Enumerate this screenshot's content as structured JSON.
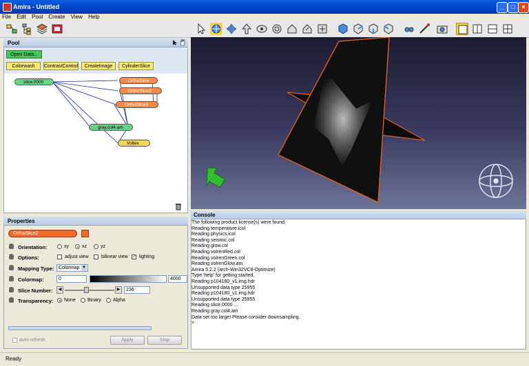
{
  "window": {
    "title": "Amira - Untitled"
  },
  "menu": [
    "File",
    "Edit",
    "Pool",
    "Create",
    "View",
    "Help"
  ],
  "pool": {
    "title": "Pool",
    "open_data": "Open Data...",
    "module_buttons": [
      "Colorwash",
      "ContrastControl",
      "CreateImage",
      "CylinderSlice"
    ],
    "nodes": {
      "slice": "slice.0000",
      "ortho1": "OrthoSlice",
      "ortho2": "OrthoSlice2",
      "ortho3": "OrthoSlice3",
      "gray": "gray.col4.am",
      "voltex": "Voltex"
    }
  },
  "properties": {
    "title": "Properties",
    "module": "OrthoSlice2",
    "orientation": {
      "label": "Orientation:",
      "options": [
        "xy",
        "xz",
        "yz"
      ],
      "selected": "xz"
    },
    "options": {
      "label": "Options:",
      "adjust": "adjust view",
      "bilinear": "bilinear view",
      "lighting": "lighting",
      "lighting_checked": true
    },
    "mapping": {
      "label": "Mapping Type:",
      "value": "Colormap"
    },
    "colormap": {
      "label": "Colormap:",
      "min": "0",
      "max": "4000"
    },
    "slice_number": {
      "label": "Slice Number:",
      "value": "236"
    },
    "transparency": {
      "label": "Transparency:",
      "options": [
        "None",
        "Binary",
        "Alpha"
      ],
      "selected": "None"
    },
    "auto_refresh": "auto-refresh",
    "apply": "Apply",
    "stop": "Stop"
  },
  "console": {
    "title": "Console",
    "lines": [
      "The following product license(s) were found:",
      "Reading temperature.icol",
      "Reading physics.icol",
      "Reading seismic.col",
      "Reading glow.col",
      "Reading volrenRed.col",
      "Reading volrenGreen.col",
      "Reading volrenGlow.am",
      "Amira 5.2.2 (arch-Win32VC8-Optimize)",
      "Type 'help' for getting started.",
      "Reading p104180_v1.img.hdr",
      "Unsupported data type 25955",
      "Reading p104180_v1.img.hdr",
      "Unsupported data type 25955",
      "Reading slice.0000 ...",
      "Reading gray.col4.am",
      "Data set too large! Please consider downsampling.",
      ">"
    ]
  },
  "status": "Ready",
  "colors": {
    "titlebar": "#0043c8",
    "accent_orange": "#f26a2a",
    "pool_green": "#45c75a",
    "module_yellow": "#f5e97a"
  }
}
